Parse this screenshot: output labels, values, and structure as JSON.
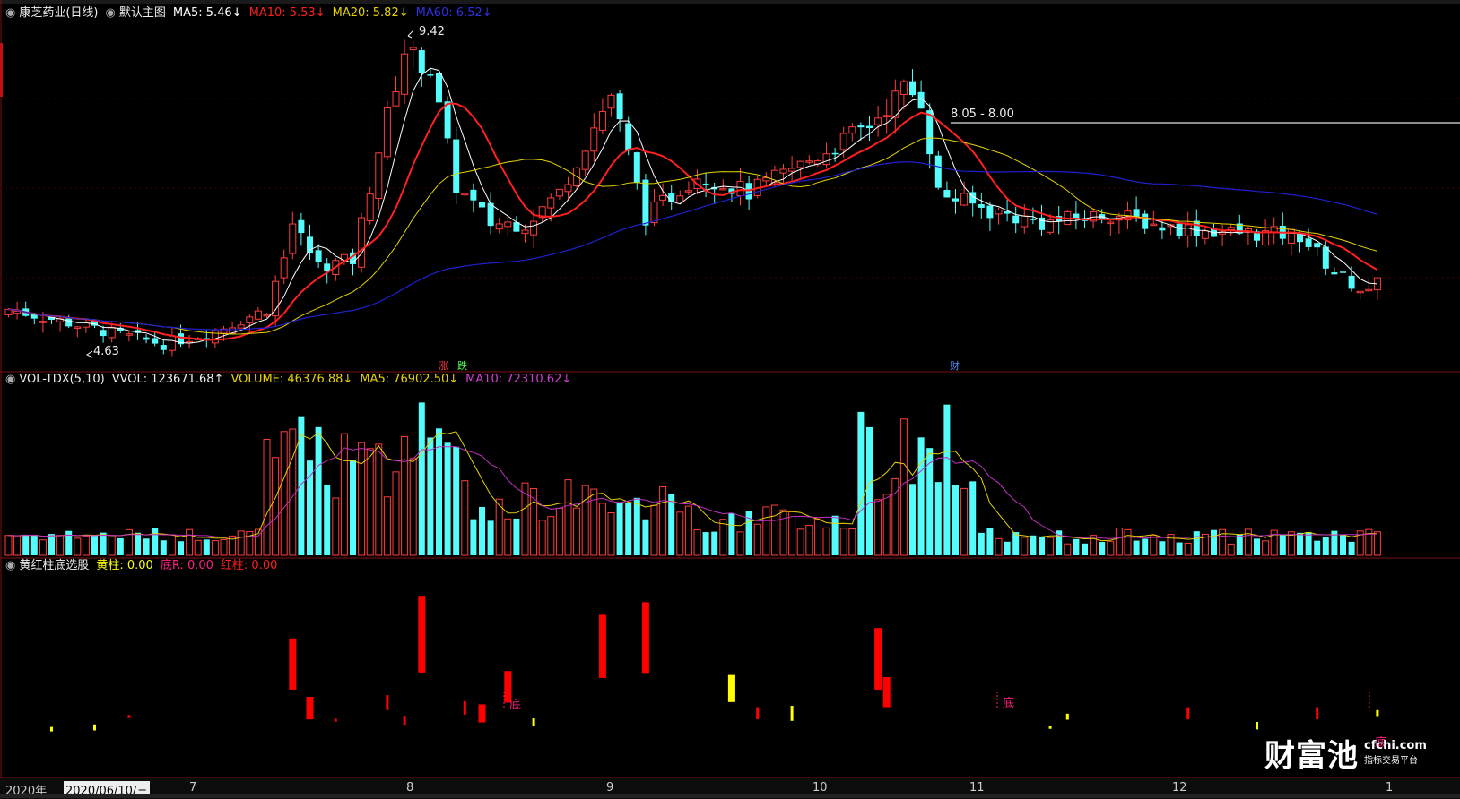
{
  "main_legend": {
    "title": "康芝药业(日线)",
    "template": "默认主图",
    "ma5": "MA5: 5.46↓",
    "ma10": "MA10: 5.53↓",
    "ma20": "MA20: 5.82↓",
    "ma60": "MA60: 6.52↓"
  },
  "vol_legend": {
    "name": "VOL-TDX(5,10)",
    "vvol": "VVOL: 123671.68↑",
    "volume": "VOLUME: 46376.88↓",
    "ma5": "MA5: 76902.50↓",
    "ma10": "MA10: 72310.62↓"
  },
  "ind_legend": {
    "name": "黄红柱底选股",
    "yellow": "黄柱: 0.00",
    "di": "底R: 0.00",
    "red": "红柱: 0.00"
  },
  "annotations": {
    "high": "9.42",
    "low": "4.63",
    "range": "8.05 - 8.00",
    "zhang": "涨",
    "die": "跌",
    "cai": "财",
    "di1": "底",
    "di2": "底",
    "di3": "底"
  },
  "x_axis": {
    "year": "2020年",
    "cursor": "2020/06/10/三",
    "months": [
      "7",
      "8",
      "9",
      "10",
      "11",
      "12",
      "1"
    ]
  },
  "logo": {
    "name": "财富池",
    "site": "cfchi.com",
    "slogan": "指标交易平台"
  },
  "colors": {
    "up": "#ff3c3c",
    "down": "#54fcfc",
    "ma5": "#ffffff",
    "ma10": "#ff2020",
    "ma20": "#e6d200",
    "ma60": "#2020d0",
    "vol_ma5": "#e6d200",
    "vol_ma10": "#c030c0",
    "yellow_bar": "#ffff00",
    "red_bar": "#ff0000",
    "di_label": "#ff2080"
  },
  "chart_data": {
    "type": "candlestick",
    "start_price": 5.1,
    "highest": 9.42,
    "lowest": 4.63,
    "indicator_bars": [
      {
        "col": 5,
        "type": "yellow",
        "v": 0.3
      },
      {
        "col": 10,
        "type": "yellow",
        "v": 0.4
      },
      {
        "col": 14,
        "type": "red",
        "v": 0.2
      },
      {
        "col": 33,
        "type": "red",
        "v": 3.4
      },
      {
        "col": 35,
        "type": "red",
        "v": 1.5
      },
      {
        "col": 38,
        "type": "red",
        "v": 0.2
      },
      {
        "col": 44,
        "type": "red",
        "v": 1.0
      },
      {
        "col": 46,
        "type": "red",
        "v": 0.6
      },
      {
        "col": 48,
        "type": "red",
        "v": 5.1
      },
      {
        "col": 53,
        "type": "red",
        "v": 0.9
      },
      {
        "col": 55,
        "type": "red",
        "v": 1.2
      },
      {
        "col": 58,
        "type": "red",
        "v": 2.1
      },
      {
        "col": 61,
        "type": "yellow",
        "v": 0.5
      },
      {
        "col": 69,
        "type": "red",
        "v": 4.2
      },
      {
        "col": 74,
        "type": "red",
        "v": 4.7
      },
      {
        "col": 84,
        "type": "yellow",
        "v": 1.8
      },
      {
        "col": 87,
        "type": "red",
        "v": 0.8
      },
      {
        "col": 91,
        "type": "yellow",
        "v": 1.0
      },
      {
        "col": 101,
        "type": "red",
        "v": 4.1
      },
      {
        "col": 102,
        "type": "red",
        "v": 2.0
      },
      {
        "col": 121,
        "type": "yellow",
        "v": 0.2
      },
      {
        "col": 123,
        "type": "yellow",
        "v": 0.4
      },
      {
        "col": 137,
        "type": "red",
        "v": 0.8
      },
      {
        "col": 145,
        "type": "yellow",
        "v": 0.5
      },
      {
        "col": 152,
        "type": "red",
        "v": 0.8
      },
      {
        "col": 159,
        "type": "yellow",
        "v": 0.4
      }
    ]
  }
}
